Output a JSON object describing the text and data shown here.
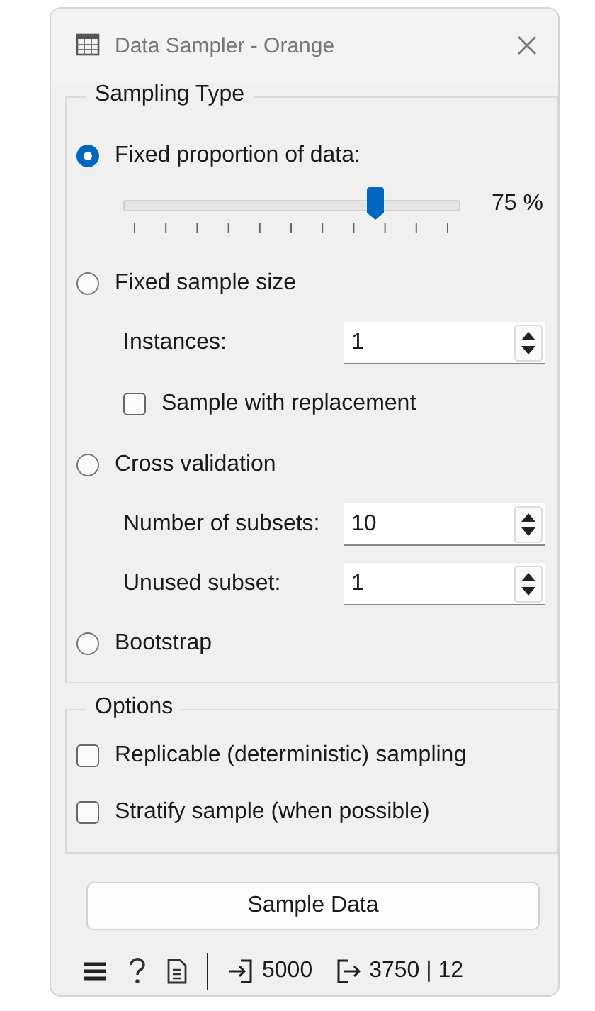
{
  "window": {
    "title": "Data Sampler - Orange"
  },
  "sampling_group": {
    "title": "Sampling Type",
    "options": [
      {
        "label": "Fixed proportion of data:",
        "selected": true,
        "slider": {
          "level": 0.75,
          "reading": "75 %"
        }
      },
      {
        "label": "Fixed sample size",
        "selected": false,
        "fields": [
          {
            "label": "Instances:",
            "value": "1"
          }
        ],
        "checkboxes": [
          {
            "label": "Sample with replacement",
            "checked": false
          }
        ]
      },
      {
        "label": "Cross validation",
        "selected": false,
        "fields": [
          {
            "label": "Number of subsets:",
            "value": "10"
          },
          {
            "label": "Unused subset:",
            "value": "1"
          }
        ]
      },
      {
        "label": "Bootstrap",
        "selected": false
      }
    ]
  },
  "options_group": {
    "title": "Options",
    "checkboxes": [
      {
        "label": "Replicable (deterministic) sampling",
        "checked": false
      },
      {
        "label": "Stratify sample (when possible)",
        "checked": false
      }
    ]
  },
  "button": "Sample Data",
  "status_bar": {
    "input_count": "5000",
    "output_count": "3750 | 12"
  }
}
